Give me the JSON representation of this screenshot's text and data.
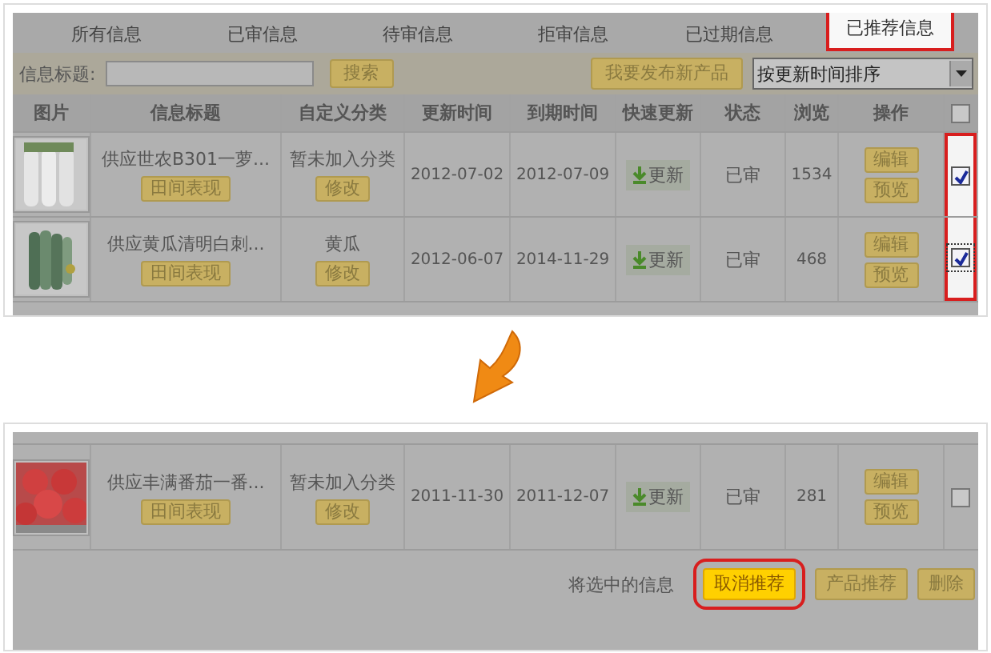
{
  "before_screen": {
    "tabs": [
      {
        "label": "所有信息",
        "selected": false
      },
      {
        "label": "已审信息",
        "selected": false
      },
      {
        "label": "待审信息",
        "selected": false
      },
      {
        "label": "拒审信息",
        "selected": false
      },
      {
        "label": "已过期信息",
        "selected": false
      },
      {
        "label": "已推荐信息",
        "selected": true
      }
    ],
    "search": {
      "label": "信息标题:",
      "button": "搜索"
    },
    "publish_button": "我要发布新产品",
    "sort_select": {
      "value": "按更新时间排序"
    },
    "columns": [
      "图片",
      "信息标题",
      "自定义分类",
      "更新时间",
      "到期时间",
      "快速更新",
      "状态",
      "浏览",
      "操作"
    ],
    "select_all": {
      "checked": false
    },
    "checkbox_column_highlighted": true,
    "rows": [
      {
        "picture": {
          "kind": "picture"
        },
        "title": "供应世农B301一萝...",
        "field_button": "田间表现",
        "category": "暂未加入分类",
        "category_button": "修改",
        "updated": "2012-07-02",
        "expires": "2012-07-09",
        "quick_update": "更新",
        "status": "已审",
        "views": "1534",
        "actions": [
          "编辑",
          "预览"
        ],
        "checked": true,
        "focused": false
      },
      {
        "picture": {
          "kind": "picture"
        },
        "title": "供应黄瓜清明白刺...",
        "field_button": "田间表现",
        "category": "黄瓜",
        "category_button": "修改",
        "updated": "2012-06-07",
        "expires": "2014-11-29",
        "quick_update": "更新",
        "status": "已审",
        "views": "468",
        "actions": [
          "编辑",
          "预览"
        ],
        "checked": true,
        "focused": true
      }
    ]
  },
  "after_screen": {
    "rows": [
      {
        "picture": {
          "kind": "picture"
        },
        "title": "供应丰满番茄一番...",
        "field_button": "田间表现",
        "category": "暂未加入分类",
        "category_button": "修改",
        "updated": "2011-11-30",
        "expires": "2011-12-07",
        "quick_update": "更新",
        "status": "已审",
        "views": "281",
        "actions": [
          "编辑",
          "预览"
        ],
        "checked": false,
        "focused": false
      }
    ],
    "footer": {
      "label": "将选中的信息",
      "buttons": [
        {
          "label": "取消推荐",
          "highlighted": true
        },
        {
          "label": "产品推荐",
          "highlighted": false
        },
        {
          "label": "删除",
          "highlighted": false
        }
      ]
    }
  }
}
